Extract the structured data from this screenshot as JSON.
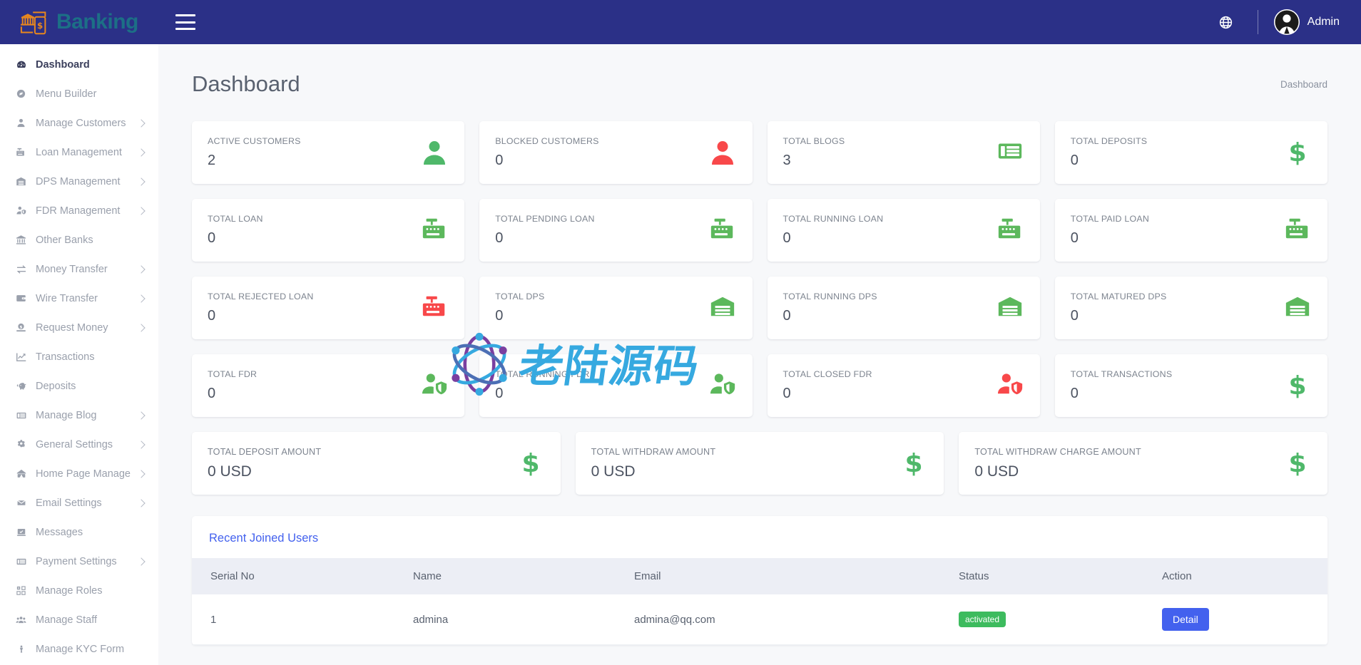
{
  "topbar": {
    "brand": "Banking",
    "brand_logo_icon": "bank-mobile-logo-icon",
    "menu_toggle_icon": "hamburger-icon",
    "language_icon": "globe-icon",
    "avatar_icon": "user-avatar-icon",
    "user_name": "Admin",
    "brand_color": "#1c6f86",
    "bar_color": "#2b3087"
  },
  "sidebar": {
    "items": [
      {
        "label": "Dashboard",
        "icon": "dashboard-icon",
        "active": true,
        "caret": false
      },
      {
        "label": "Menu Builder",
        "icon": "compass-icon",
        "active": false,
        "caret": false
      },
      {
        "label": "Manage Customers",
        "icon": "user-icon",
        "active": false,
        "caret": true
      },
      {
        "label": "Loan Management",
        "icon": "cash-register-icon",
        "active": false,
        "caret": true
      },
      {
        "label": "DPS Management",
        "icon": "warehouse-icon",
        "active": false,
        "caret": true
      },
      {
        "label": "FDR Management",
        "icon": "user-shield-icon",
        "active": false,
        "caret": true
      },
      {
        "label": "Other Banks",
        "icon": "bank-icon",
        "active": false,
        "caret": false
      },
      {
        "label": "Money Transfer",
        "icon": "exchange-arrows-icon",
        "active": false,
        "caret": true
      },
      {
        "label": "Wire Transfer",
        "icon": "wallet-icon",
        "active": false,
        "caret": true
      },
      {
        "label": "Request Money",
        "icon": "money-request-icon",
        "active": false,
        "caret": true
      },
      {
        "label": "Transactions",
        "icon": "chart-line-icon",
        "active": false,
        "caret": false
      },
      {
        "label": "Deposits",
        "icon": "piggy-bank-icon",
        "active": false,
        "caret": false
      },
      {
        "label": "Manage Blog",
        "icon": "newspaper-icon",
        "active": false,
        "caret": true
      },
      {
        "label": "General Settings",
        "icon": "gears-icon",
        "active": false,
        "caret": true
      },
      {
        "label": "Home Page Manage",
        "icon": "home-icon",
        "active": false,
        "caret": true
      },
      {
        "label": "Email Settings",
        "icon": "envelope-icon",
        "active": false,
        "caret": true
      },
      {
        "label": "Messages",
        "icon": "message-icon",
        "active": false,
        "caret": false
      },
      {
        "label": "Payment Settings",
        "icon": "payment-card-icon",
        "active": false,
        "caret": true
      },
      {
        "label": "Manage Roles",
        "icon": "roles-icon",
        "active": false,
        "caret": false
      },
      {
        "label": "Manage Staff",
        "icon": "users-group-icon",
        "active": false,
        "caret": false
      },
      {
        "label": "Manage KYC Form",
        "icon": "kyc-person-icon",
        "active": false,
        "caret": false
      }
    ]
  },
  "page": {
    "title": "Dashboard",
    "breadcrumb": "Dashboard"
  },
  "stats": [
    {
      "label": "ACTIVE CUSTOMERS",
      "value": "2",
      "icon": "user-icon",
      "color": "#4fb86a"
    },
    {
      "label": "BLOCKED CUSTOMERS",
      "value": "0",
      "icon": "user-icon",
      "color": "#f8484a"
    },
    {
      "label": "TOTAL BLOGS",
      "value": "3",
      "icon": "newspaper-icon",
      "color": "#5cb85c"
    },
    {
      "label": "TOTAL DEPOSITS",
      "value": "0",
      "icon": "dollar-sign-icon",
      "color": "#4fb86a"
    },
    {
      "label": "TOTAL LOAN",
      "value": "0",
      "icon": "cash-register-icon",
      "color": "#5cb85c"
    },
    {
      "label": "TOTAL PENDING LOAN",
      "value": "0",
      "icon": "cash-register-icon",
      "color": "#5cb85c"
    },
    {
      "label": "TOTAL RUNNING LOAN",
      "value": "0",
      "icon": "cash-register-icon",
      "color": "#5cb85c"
    },
    {
      "label": "TOTAL PAID LOAN",
      "value": "0",
      "icon": "cash-register-icon",
      "color": "#5cb85c"
    },
    {
      "label": "TOTAL REJECTED LOAN",
      "value": "0",
      "icon": "cash-register-icon",
      "color": "#f8484a"
    },
    {
      "label": "TOTAL DPS",
      "value": "0",
      "icon": "warehouse-icon",
      "color": "#5cb85c"
    },
    {
      "label": "TOTAL RUNNING DPS",
      "value": "0",
      "icon": "warehouse-icon",
      "color": "#5cb85c"
    },
    {
      "label": "TOTAL MATURED DPS",
      "value": "0",
      "icon": "warehouse-icon",
      "color": "#5cb85c"
    },
    {
      "label": "TOTAL FDR",
      "value": "0",
      "icon": "user-shield-icon",
      "color": "#5cb85c"
    },
    {
      "label": "TOTAL RUNNING FDR",
      "value": "0",
      "icon": "user-shield-icon",
      "color": "#5cb85c"
    },
    {
      "label": "TOTAL CLOSED FDR",
      "value": "0",
      "icon": "user-shield-icon",
      "color": "#f8484a"
    },
    {
      "label": "TOTAL TRANSACTIONS",
      "value": "0",
      "icon": "dollar-sign-icon",
      "color": "#4fb86a"
    }
  ],
  "amount_cards": [
    {
      "label": "TOTAL DEPOSIT AMOUNT",
      "value": "0 USD",
      "icon": "dollar-sign-icon",
      "color": "#4fb86a"
    },
    {
      "label": "TOTAL WITHDRAW AMOUNT",
      "value": "0 USD",
      "icon": "dollar-sign-icon",
      "color": "#4fb86a"
    },
    {
      "label": "TOTAL WITHDRAW CHARGE AMOUNT",
      "value": "0 USD",
      "icon": "dollar-sign-icon",
      "color": "#4fb86a"
    }
  ],
  "recent_users": {
    "title": "Recent Joined Users",
    "columns": [
      "Serial No",
      "Name",
      "Email",
      "Status",
      "Action"
    ],
    "rows": [
      {
        "serial": "1",
        "name": "admina",
        "email": "admina@qq.com",
        "status": "activated",
        "action_label": "Detail"
      }
    ]
  },
  "watermark": {
    "text": "老陆源码",
    "logo_icon": "atom-circle-logo-icon",
    "color": "#36a9e0"
  }
}
